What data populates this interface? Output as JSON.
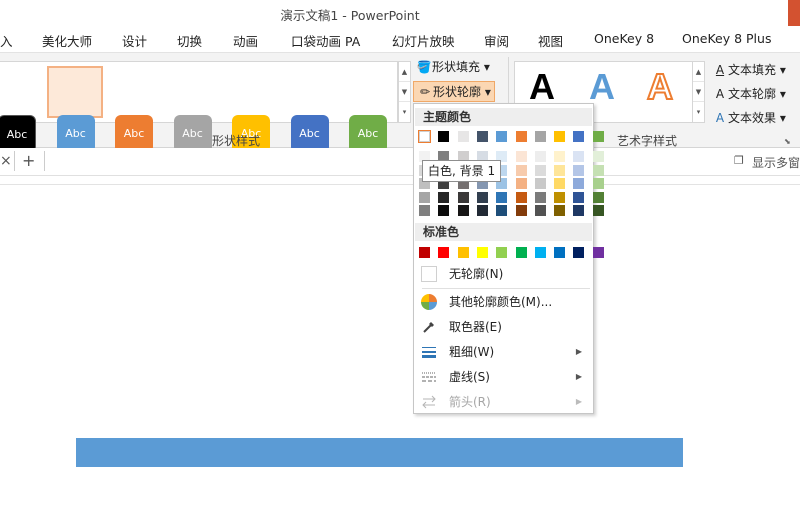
{
  "titlebar": {
    "title": "演示文稿1 - PowerPoint"
  },
  "tabs": [
    "入",
    "美化大师",
    "设计",
    "切换",
    "动画",
    "口袋动画 PA",
    "幻灯片放映",
    "审阅",
    "视图",
    "OneKey 8",
    "OneKey 8 Plus"
  ],
  "ribbon": {
    "gallery": {
      "swatch_text": "Abc",
      "colors": [
        "#000000",
        "#5b9bd5",
        "#ed7d31",
        "#a5a5a5",
        "#ffc000",
        "#4472c4",
        "#70ad47"
      ]
    },
    "shape_fill": "形状填充",
    "shape_outline": "形状轮廓",
    "shape_styles_label": "形状样式",
    "wordart_letter": "A",
    "wordart_label": "艺术字样式",
    "text_fill": "文本填充",
    "text_outline": "文本轮廓",
    "text_effects": "文本效果"
  },
  "docbar": {
    "close": "×",
    "add": "+",
    "show_multi": "显示多窗"
  },
  "menu": {
    "theme_colors_title": "主题颜色",
    "theme_top_row": [
      "#ffffff",
      "#000000",
      "#e7e6e6",
      "#44546a",
      "#5b9bd5",
      "#ed7d31",
      "#a5a5a5",
      "#ffc000",
      "#4472c4",
      "#70ad47"
    ],
    "theme_shades": [
      [
        "#f2f2f2",
        "#7f7f7f",
        "#d0cece",
        "#d6dce4",
        "#deebf6",
        "#fbe5d5",
        "#ededed",
        "#fff2cc",
        "#dae3f3",
        "#e2efd9"
      ],
      [
        "#d8d8d8",
        "#595959",
        "#aeabab",
        "#adb9ca",
        "#bdd7ee",
        "#f7cbac",
        "#dbdbdb",
        "#fee599",
        "#b4c6e7",
        "#c5e0b3"
      ],
      [
        "#bfbfbf",
        "#3f3f3f",
        "#757070",
        "#8496b0",
        "#9cc3e5",
        "#f4b183",
        "#c9c9c9",
        "#ffd965",
        "#8eaadb",
        "#a8d08d"
      ],
      [
        "#a5a5a5",
        "#262626",
        "#3a3838",
        "#323f4f",
        "#2e75b5",
        "#c55a11",
        "#7b7b7b",
        "#bf9000",
        "#2f5496",
        "#538135"
      ],
      [
        "#7f7f7f",
        "#0c0c0c",
        "#171616",
        "#222a35",
        "#1e4e79",
        "#833c0b",
        "#525252",
        "#7f6000",
        "#1f3864",
        "#375623"
      ]
    ],
    "tooltip": "白色, 背景 1",
    "standard_colors_title": "标准色",
    "standard_colors": [
      "#c00000",
      "#ff0000",
      "#ffc000",
      "#ffff00",
      "#92d050",
      "#00b050",
      "#00b0f0",
      "#0070c0",
      "#002060",
      "#7030a0"
    ],
    "no_outline": "无轮廓(N)",
    "more_colors": "其他轮廓颜色(M)...",
    "eyedropper": "取色器(E)",
    "weight": "粗细(W)",
    "dashes": "虚线(S)",
    "arrows": "箭头(R)"
  },
  "shape": {
    "fill": "#5b9bd5"
  }
}
